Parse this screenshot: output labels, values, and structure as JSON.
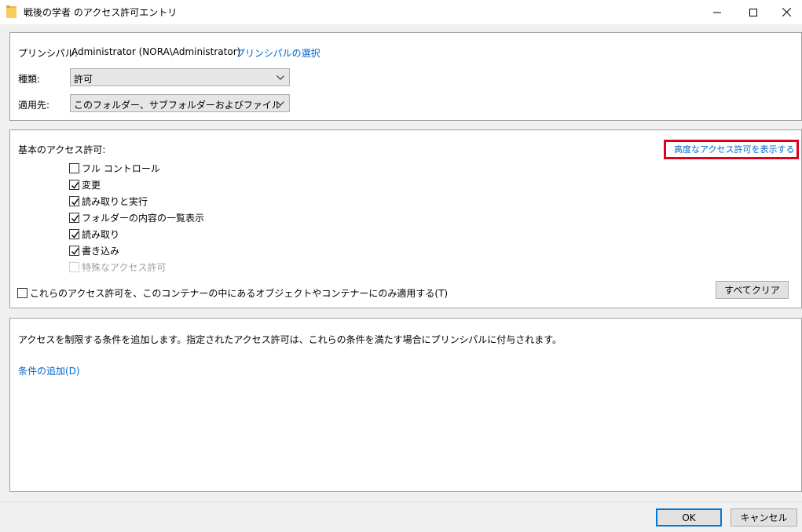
{
  "window": {
    "title": "戦後の学者 のアクセス許可エントリ",
    "controls": {
      "minimize": "minimize-icon",
      "maximize": "maximize-icon",
      "close": "close-icon"
    }
  },
  "principal": {
    "label": "プリンシパル:",
    "value": "Administrator (NORA\\Administrator)",
    "select_link": "プリンシパルの選択"
  },
  "type": {
    "label": "種類:",
    "value": "許可"
  },
  "applies_to": {
    "label": "適用先:",
    "value": "このフォルダー、サブフォルダーおよびファイル"
  },
  "basic_permissions": {
    "heading": "基本のアクセス許可:",
    "advanced_link": "高度なアクセス許可を表示する",
    "items": [
      {
        "label": "フル コントロール",
        "checked": false,
        "enabled": true
      },
      {
        "label": "変更",
        "checked": true,
        "enabled": true
      },
      {
        "label": "読み取りと実行",
        "checked": true,
        "enabled": true
      },
      {
        "label": "フォルダーの内容の一覧表示",
        "checked": true,
        "enabled": true
      },
      {
        "label": "読み取り",
        "checked": true,
        "enabled": true
      },
      {
        "label": "書き込み",
        "checked": true,
        "enabled": true
      },
      {
        "label": "特殊なアクセス許可",
        "checked": false,
        "enabled": false
      }
    ],
    "apply_only_label": "これらのアクセス許可を、このコンテナーの中にあるオブジェクトやコンテナーにのみ適用する(T)",
    "clear_all": "すべてクリア"
  },
  "conditions": {
    "description": "アクセスを制限する条件を追加します。指定されたアクセス許可は、これらの条件を満たす場合にプリンシパルに付与されます。",
    "add_link": "条件の追加(D)"
  },
  "buttons": {
    "ok": "OK",
    "cancel": "キャンセル"
  },
  "colors": {
    "link": "#0066cc",
    "highlight": "#e0001b",
    "default_button_border": "#0078d7"
  }
}
